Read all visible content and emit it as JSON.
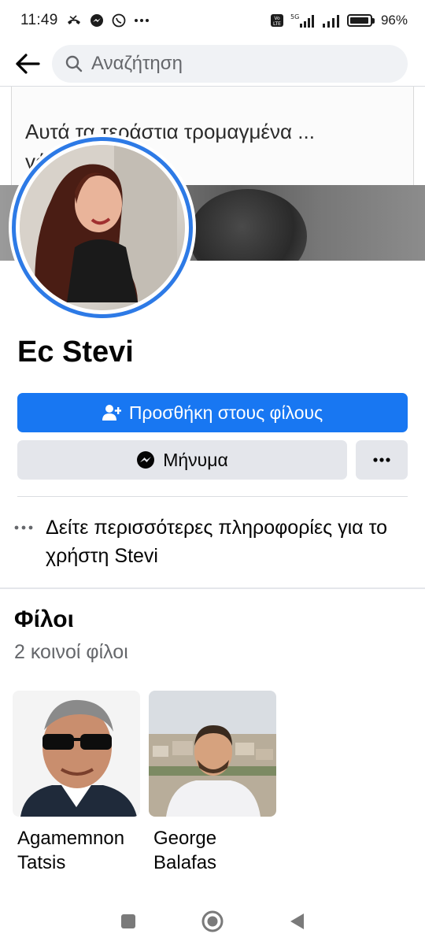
{
  "status_bar": {
    "time": "11:49",
    "network_label": "5G",
    "volte_label": "Vo LTE",
    "battery_percent": "96%",
    "battery_level": 0.96
  },
  "search": {
    "placeholder": "Αναζήτηση"
  },
  "cover": {
    "caption": "Αυτά τα τεράστια τρομαγμένα ... γάνε..."
  },
  "profile": {
    "name": "Ec Stevi"
  },
  "actions": {
    "add_friend_label": "Προσθήκη στους φίλους",
    "message_label": "Μήνυμα"
  },
  "info": {
    "text": "Δείτε περισσότερες πληροφορίες για το χρήστη Stevi"
  },
  "friends": {
    "title": "Φίλοι",
    "mutual_count": "2 κοινοί φίλοι",
    "items": [
      {
        "name": "Agamemnon Tatsis"
      },
      {
        "name": "George Balafas"
      }
    ]
  },
  "colors": {
    "accent": "#1877f2",
    "avatar_ring": "#2d7ae6",
    "button_grey": "#e4e6eb"
  }
}
